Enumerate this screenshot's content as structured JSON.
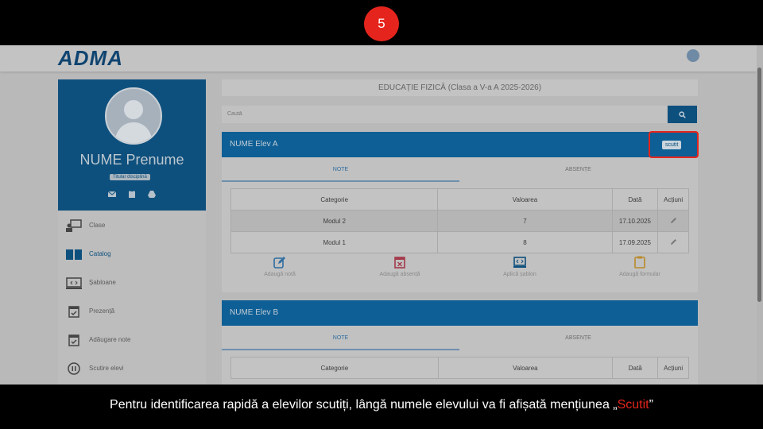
{
  "step": {
    "number": "5"
  },
  "header": {
    "logo": "ADMA"
  },
  "sidebar": {
    "name": "NUME Prenume",
    "role": "Titular disciplină",
    "items": [
      {
        "label": "Clase",
        "icon": "class-presentation-icon",
        "active": false
      },
      {
        "label": "Catalog",
        "icon": "open-book-icon",
        "active": true
      },
      {
        "label": "Șabloane",
        "icon": "template-icon",
        "active": false
      },
      {
        "label": "Prezență",
        "icon": "calendar-check-icon",
        "active": false
      },
      {
        "label": "Adăugare note",
        "icon": "calendar-check-icon",
        "active": false
      },
      {
        "label": "Scutire elevi",
        "icon": "pause-circle-icon",
        "active": false
      }
    ]
  },
  "main": {
    "course_title": "EDUCAȚIE FIZICĂ (Clasa a V-a A 2025-2026)",
    "search_placeholder": "Caută",
    "students": [
      {
        "name": "NUME Elev A",
        "badge": "scutit",
        "tabs": [
          "NOTE",
          "ABSENȚE"
        ],
        "table": {
          "headers": [
            "Categorie",
            "Valoarea",
            "Dată",
            "Acțiuni"
          ],
          "rows": [
            [
              "Modul 2",
              "7",
              "17.10.2025"
            ],
            [
              "Modul 1",
              "8",
              "17.09.2025"
            ]
          ]
        },
        "actions": [
          "Adaugă notă",
          "Adaugă absență",
          "Aplică șablon",
          "Adaugă formular"
        ]
      },
      {
        "name": "NUME Elev B",
        "tabs": [
          "NOTE",
          "ABSENȚE"
        ],
        "table": {
          "headers": [
            "Categorie",
            "Valoarea",
            "Dată",
            "Acțiuni"
          ]
        }
      }
    ]
  },
  "caption": {
    "text": "Pentru identificarea rapidă a elevilor scutiți, lângă numele elevului va fi afișată mențiunea „",
    "highlight": "Scutit",
    "end": "”"
  },
  "colors": {
    "primary": "#0e507d",
    "highlight": "#e5251d"
  }
}
